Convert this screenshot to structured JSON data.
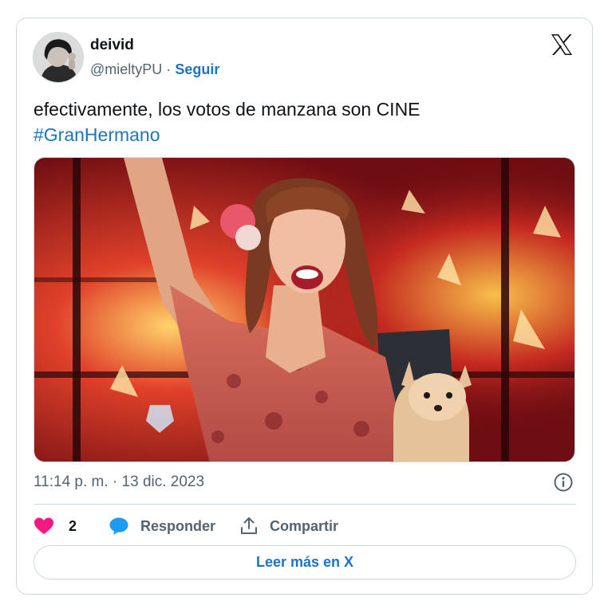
{
  "tweet": {
    "author": {
      "name": "deivid",
      "handle": "@mieltyPU",
      "separator": "·",
      "follow_label": "Seguir"
    },
    "text": "efectivamente, los votos de manzana son CINE",
    "hashtag": "#GranHermano",
    "timestamp": "11:14 p. m. · 13 dic. 2023",
    "actions": {
      "like_count": "2",
      "reply_label": "Responder",
      "share_label": "Compartir"
    },
    "read_more_label": "Leer más en X"
  },
  "icons": {
    "logo": "x-logo-icon",
    "info": "info-icon",
    "like": "heart-icon",
    "reply": "speech-bubble-icon",
    "share": "share-upload-icon"
  },
  "colors": {
    "link": "#1d74c3",
    "heart": "#f91880",
    "reply": "#1d9bf0",
    "muted": "#536471",
    "border": "#cfd9de"
  }
}
